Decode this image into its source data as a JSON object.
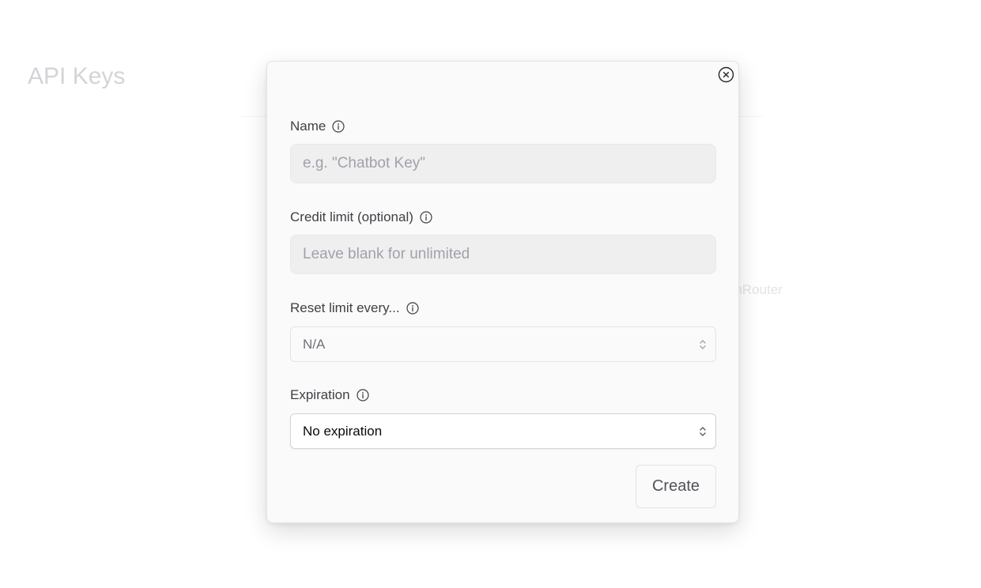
{
  "background": {
    "page_title": "API Keys",
    "partial_text": "enRouter"
  },
  "modal": {
    "fields": {
      "name": {
        "label": "Name",
        "placeholder": "e.g. \"Chatbot Key\"",
        "value": ""
      },
      "credit_limit": {
        "label": "Credit limit (optional)",
        "placeholder": "Leave blank for unlimited",
        "value": ""
      },
      "reset_limit": {
        "label": "Reset limit every...",
        "selected": "N/A"
      },
      "expiration": {
        "label": "Expiration",
        "selected": "No expiration"
      }
    },
    "create_label": "Create"
  },
  "icons": {
    "close": "close-icon",
    "info": "info-icon",
    "select": "chevron-up-down-icon"
  }
}
